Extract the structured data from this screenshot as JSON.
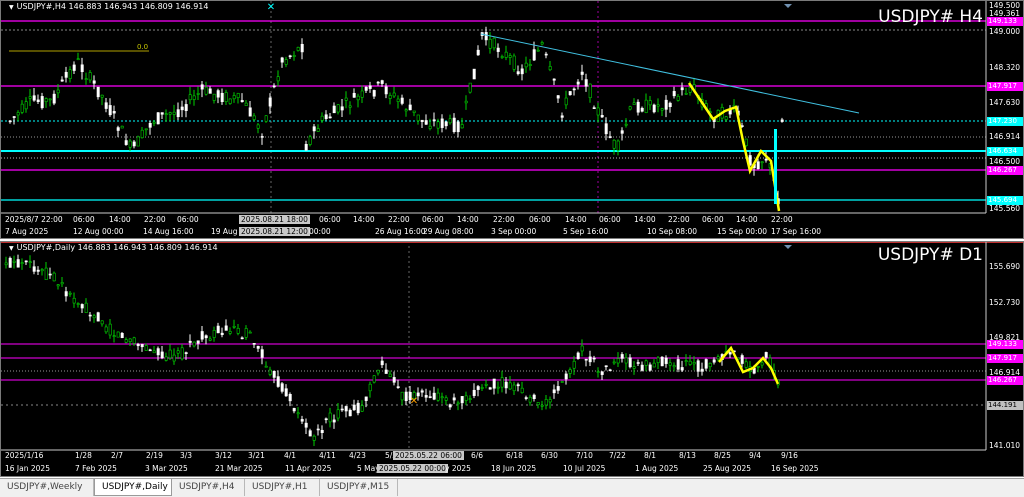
{
  "h4": {
    "info": "USDJPY#,H4  146.883 146.943 146.809 146.914",
    "title": "USDJPY# H4",
    "fib_label": "0.0",
    "price_scale": [
      "149.500",
      "149.361",
      "149.000",
      "148.320",
      "147.630",
      "146.914",
      "146.500",
      "145.560"
    ],
    "price_tags": [
      {
        "text": "149.133",
        "color": "#ff00ff",
        "bg": "#ff00ff"
      },
      {
        "text": "147.917",
        "color": "#ff00ff",
        "bg": "#ff00ff"
      },
      {
        "text": "147.230",
        "color": "#00ffff",
        "bg": "#00ffff"
      },
      {
        "text": "146.634",
        "color": "#00ffff",
        "bg": "#00ffff"
      },
      {
        "text": "146.267",
        "color": "#ff00ff",
        "bg": "#ff00ff"
      },
      {
        "text": "145.694",
        "color": "#00ffff",
        "bg": "#00ffff"
      }
    ],
    "time_row1": [
      "2025/8/7 22:00",
      "06:00",
      "14:00",
      "22:00",
      "06:00",
      "2025.08.21 18:00",
      "06:00",
      "14:00",
      "22:00",
      "06:00",
      "14:00",
      "22:00",
      "06:00",
      "14:00",
      "06:00",
      "14:00",
      "22:00",
      "06:00",
      "14:00",
      "22:00"
    ],
    "time_row2": [
      "7 Aug 2025",
      "12 Aug 00:00",
      "14 Aug 16:00",
      "19 Aug",
      "2025.08.21 12:00",
      "00:00",
      "26 Aug 16:00",
      "29 Aug 08:00",
      "3 Sep 00:00",
      "5 Sep 16:00",
      "10 Sep 08:00",
      "15 Sep 00:00",
      "17 Sep 16:00"
    ]
  },
  "d1": {
    "info": "USDJPY#,Daily  146.883 146.943 146.809 146.914",
    "title": "USDJPY# D1",
    "price_scale": [
      "155.690",
      "152.730",
      "149.821",
      "146.914",
      "141.010"
    ],
    "price_tags": [
      {
        "text": "149.133",
        "color": "#ff00ff",
        "bg": "#ff00ff"
      },
      {
        "text": "147.917",
        "color": "#ff00ff",
        "bg": "#ff00ff"
      },
      {
        "text": "146.267",
        "color": "#ff00ff",
        "bg": "#ff00ff"
      },
      {
        "text": "144.191",
        "color": "#808080",
        "bg": "#c0c0c0"
      }
    ],
    "time_row1": [
      "2025/1/16",
      "1/28",
      "2/7",
      "2/19",
      "3/3",
      "3/12",
      "3/21",
      "4/1",
      "4/11",
      "4/23",
      "5/5",
      "2025.05.22 06:00",
      "6/6",
      "6/18",
      "6/30",
      "7/10",
      "7/22",
      "8/1",
      "8/13",
      "8/25",
      "9/4",
      "9/16"
    ],
    "time_row2": [
      "16 Jan 2025",
      "7 Feb 2025",
      "3 Mar 2025",
      "21 Mar 2025",
      "11 Apr 2025",
      "5 May",
      "2025.05.22 00:00",
      "y 2025",
      "18 Jun 2025",
      "10 Jul 2025",
      "1 Aug 2025",
      "25 Aug 2025",
      "16 Sep 2025"
    ]
  },
  "tabs": [
    "USDJPY#,Weekly",
    "USDJPY#,Daily",
    "USDJPY#,H4",
    "USDJPY#,H1",
    "USDJPY#,M15"
  ],
  "active_tab": "USDJPY#,Daily",
  "colors": {
    "bull": "#00d000",
    "bear": "#ffffff",
    "magenta": "#ff00ff",
    "cyan": "#00ffff",
    "zigzag": "#ffff00",
    "trendline": "#40c0e0"
  }
}
